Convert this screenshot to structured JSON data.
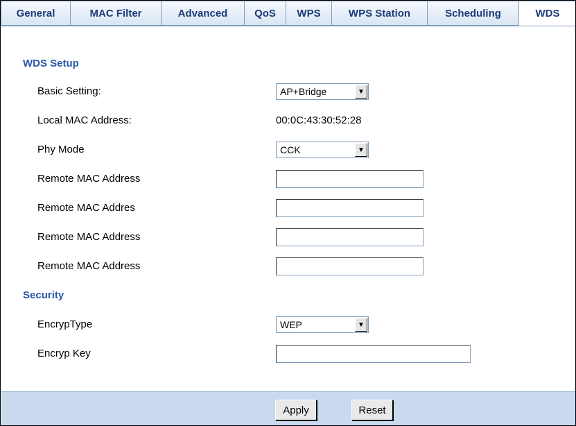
{
  "tabs": [
    {
      "label": "General"
    },
    {
      "label": "MAC Filter"
    },
    {
      "label": "Advanced"
    },
    {
      "label": "QoS"
    },
    {
      "label": "WPS"
    },
    {
      "label": "WPS Station"
    },
    {
      "label": "Scheduling"
    },
    {
      "label": "WDS"
    }
  ],
  "active_tab": "WDS",
  "wds_setup": {
    "title": "WDS Setup",
    "basic_setting_label": "Basic Setting:",
    "basic_setting_value": "AP+Bridge",
    "local_mac_label": "Local MAC Address:",
    "local_mac_value": "00:0C:43:30:52:28",
    "phy_mode_label": "Phy Mode",
    "phy_mode_value": "CCK",
    "remote_mac_1_label": "Remote MAC Address",
    "remote_mac_2_label": "Remote MAC Addres",
    "remote_mac_3_label": "Remote MAC Address",
    "remote_mac_4_label": "Remote MAC Address",
    "remote_mac_1_value": "",
    "remote_mac_2_value": "",
    "remote_mac_3_value": "",
    "remote_mac_4_value": ""
  },
  "security": {
    "title": "Security",
    "encryp_type_label": "EncrypType",
    "encryp_type_value": "WEP",
    "encryp_key_label": "Encryp Key",
    "encryp_key_value": ""
  },
  "footer": {
    "apply_label": "Apply",
    "reset_label": "Reset"
  },
  "colors": {
    "section_title": "#2a59a8",
    "footer_bg": "#c9d9ee",
    "tab_text": "#1c3c78"
  }
}
